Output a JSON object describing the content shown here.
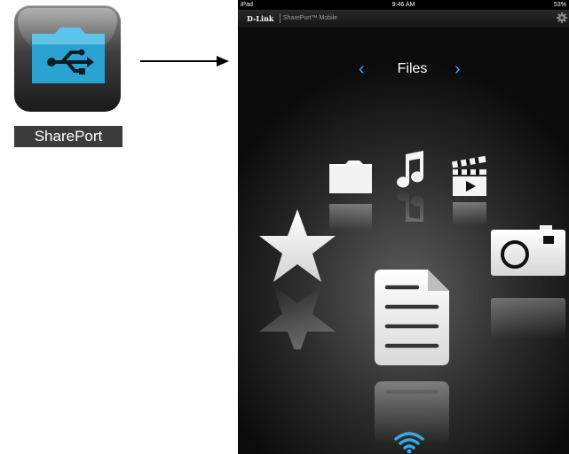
{
  "app_icon": {
    "label": "SharePort",
    "tile_color": "#2aa3d3"
  },
  "screen": {
    "status": {
      "left": "iPad",
      "time": "9:46 AM",
      "right": "53%"
    },
    "brand": {
      "logo": "D-Link",
      "app_name": "SharePort™ Mobile"
    },
    "title": "Files",
    "accent": "#3aa8e6",
    "categories": [
      {
        "name": "folder",
        "icon": "folder-icon"
      },
      {
        "name": "music",
        "icon": "music-note-icon"
      },
      {
        "name": "video",
        "icon": "clapperboard-icon"
      },
      {
        "name": "favorites",
        "icon": "star-icon"
      },
      {
        "name": "documents",
        "icon": "document-icon"
      },
      {
        "name": "photos",
        "icon": "camera-icon"
      }
    ]
  }
}
